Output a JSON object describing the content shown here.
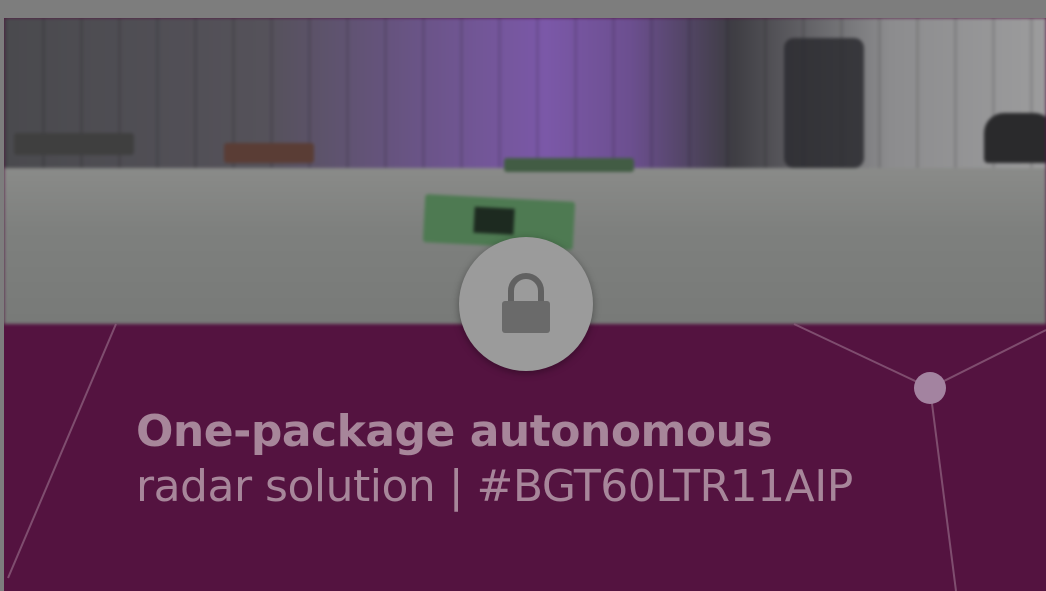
{
  "thumbnail": {
    "title_bold": "One-package autonomous",
    "title_regular": "radar solution | #BGT60LTR11AIP"
  },
  "lock_button": {
    "icon": "lock-icon"
  },
  "colors": {
    "banner": "#541340",
    "overlay": "#7d7d7d",
    "title_text": "#a7869a",
    "lock_circle": "#9b9b9b"
  }
}
